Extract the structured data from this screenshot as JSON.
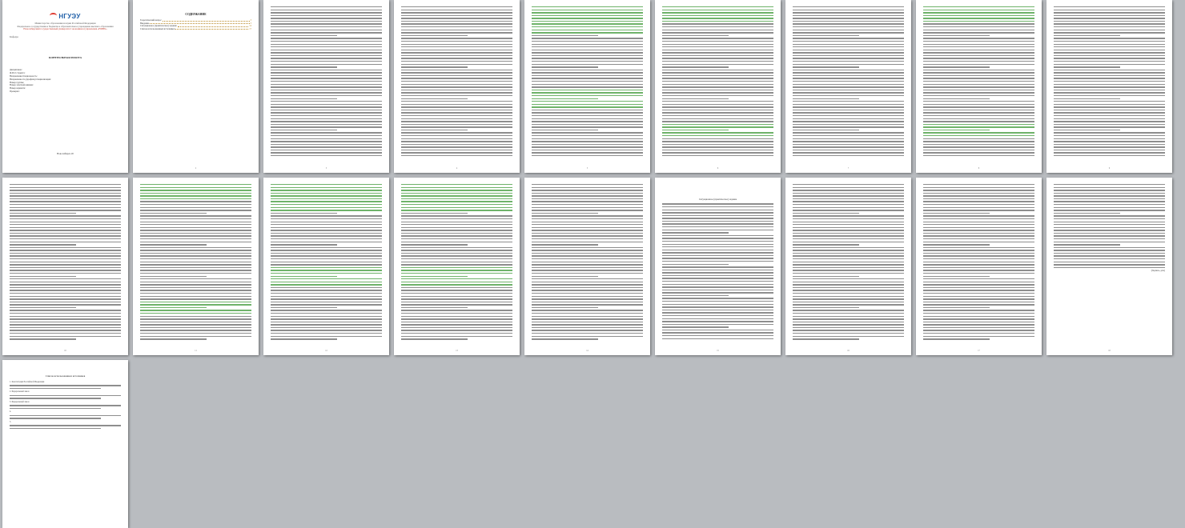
{
  "title_page": {
    "logo": "НГУЭУ",
    "ministry": "Министерство образования и науки Российской Федерации",
    "university": "Федеральное государственное бюджетное образовательное учреждение высшего образования",
    "university_name": "Новосибирский государственный университет экономики и управления «НИНХ»",
    "department": "Кафедра",
    "work_type": "КОНТРОЛЬНАЯ РАБОТА",
    "fields": [
      {
        "label": "Дисциплина:",
        "value": ""
      },
      {
        "label": "Ф.И.О студента:",
        "value": ""
      },
      {
        "label": "Направление/специальность:",
        "value": ""
      },
      {
        "label": "Направленность (профиль)/специализация:",
        "value": ""
      },
      {
        "label": "Номер группы:",
        "value": ""
      },
      {
        "label": "Номер зачетной книжки:",
        "value": ""
      },
      {
        "label": "Номер варианта:",
        "value": ""
      },
      {
        "label": "Проверил:",
        "value": ""
      }
    ],
    "city": "Новосибирск 20"
  },
  "contents": {
    "heading": "СОДЕРЖАНИЕ",
    "rows": [
      {
        "label": "Теоретический вопрос",
        "page": "3"
      },
      {
        "label": "Введение",
        "page": "3"
      },
      {
        "label": "Ситуационное (практическое) задание",
        "page": "14"
      },
      {
        "label": "Список использованных источников",
        "page": "17"
      }
    ]
  },
  "task_heading": "Ситуационное (практическое) задание",
  "references": {
    "heading": "Список использованных источников",
    "items": [
      "1. Конституция Российской Федерации",
      "2. Федеральный закон",
      "3. Федеральный закон",
      "4.",
      "5."
    ]
  },
  "signature": "(Подпись, дата)",
  "page_numbers": [
    "2",
    "3",
    "4",
    "5",
    "6",
    "7",
    "8",
    "9",
    "10",
    "11",
    "12",
    "13",
    "14",
    "15",
    "16",
    "17",
    "18"
  ]
}
